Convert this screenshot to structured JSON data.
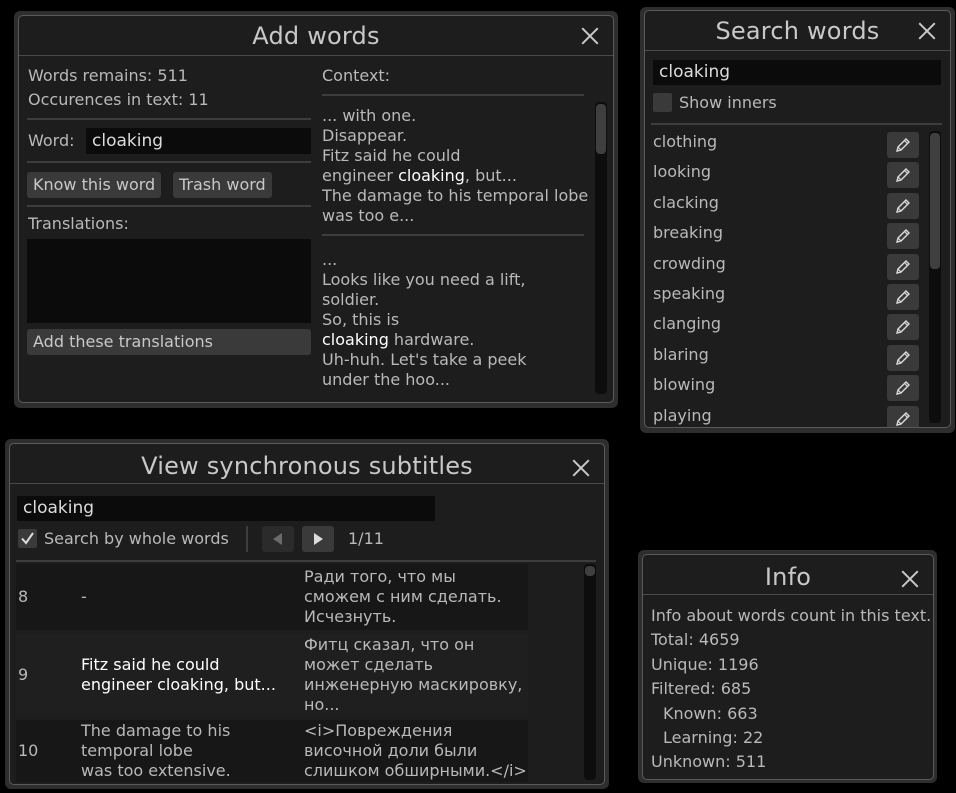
{
  "add_words": {
    "title": "Add words",
    "words_remains": "Words remains: 511",
    "occurences": "Occurences in text: 11",
    "word_label": "Word:",
    "word_value": "cloaking",
    "know_button": "Know this word",
    "trash_button": "Trash word",
    "translations_label": "Translations:",
    "add_translations_button": "Add these translations",
    "context_label": "Context:",
    "context_blocks": [
      {
        "lines": [
          [
            {
              "t": "... with one."
            }
          ],
          [
            {
              "t": "Disappear."
            }
          ],
          [
            {
              "t": "Fitz said he could"
            }
          ],
          [
            {
              "t": "engineer "
            },
            {
              "t": "cloaking",
              "hl": true
            },
            {
              "t": ", but..."
            }
          ],
          [
            {
              "t": "The damage to his temporal lobe"
            }
          ],
          [
            {
              "t": "was too e..."
            }
          ]
        ]
      },
      {
        "lines": [
          [
            {
              "t": "..."
            }
          ],
          [
            {
              "t": "Looks like you need a lift,"
            }
          ],
          [
            {
              "t": "soldier."
            }
          ],
          [
            {
              "t": "So, this is"
            }
          ],
          [
            {
              "t": "cloaking",
              "hl": true
            },
            {
              "t": " hardware."
            }
          ],
          [
            {
              "t": "Uh-huh. Let's take a peek"
            }
          ],
          [
            {
              "t": "under the hoo..."
            }
          ]
        ]
      }
    ]
  },
  "search_words": {
    "title": "Search words",
    "query": "cloaking",
    "show_inners_label": "Show inners",
    "results": [
      "clothing",
      "looking",
      "clacking",
      "breaking",
      "crowding",
      "speaking",
      "clanging",
      "blaring",
      "blowing",
      "playing"
    ]
  },
  "subtitles": {
    "title": "View synchronous subtitles",
    "query": "cloaking",
    "whole_words_label": "Search by whole words",
    "page_counter": "1/11",
    "rows": [
      {
        "num": "8",
        "left": [
          "-"
        ],
        "right": [
          "Ради того, что мы",
          "сможем с ним сделать.",
          "Исчезнуть."
        ],
        "bright": false
      },
      {
        "num": "9",
        "left": [
          "Fitz said he could",
          "engineer cloaking, but..."
        ],
        "right": [
          "Фитц сказал, что он",
          "может сделать",
          "инженерную маскировку,",
          "но..."
        ],
        "bright": true
      },
      {
        "num": "10",
        "left": [
          "The damage to his",
          "temporal lobe",
          "was too extensive."
        ],
        "right": [
          "<i>Повреждения",
          "височной доли были",
          "слишком обширными.</i>"
        ],
        "bright": false
      }
    ]
  },
  "info": {
    "title": "Info",
    "lines": [
      {
        "text": "Info about words count in this text.",
        "indent": false
      },
      {
        "text": "Total: 4659",
        "indent": false
      },
      {
        "text": "Unique: 1196",
        "indent": false
      },
      {
        "text": "Filtered: 685",
        "indent": false
      },
      {
        "text": "Known: 663",
        "indent": true
      },
      {
        "text": "Learning: 22",
        "indent": true
      },
      {
        "text": "Unknown: 511",
        "indent": false
      }
    ]
  }
}
